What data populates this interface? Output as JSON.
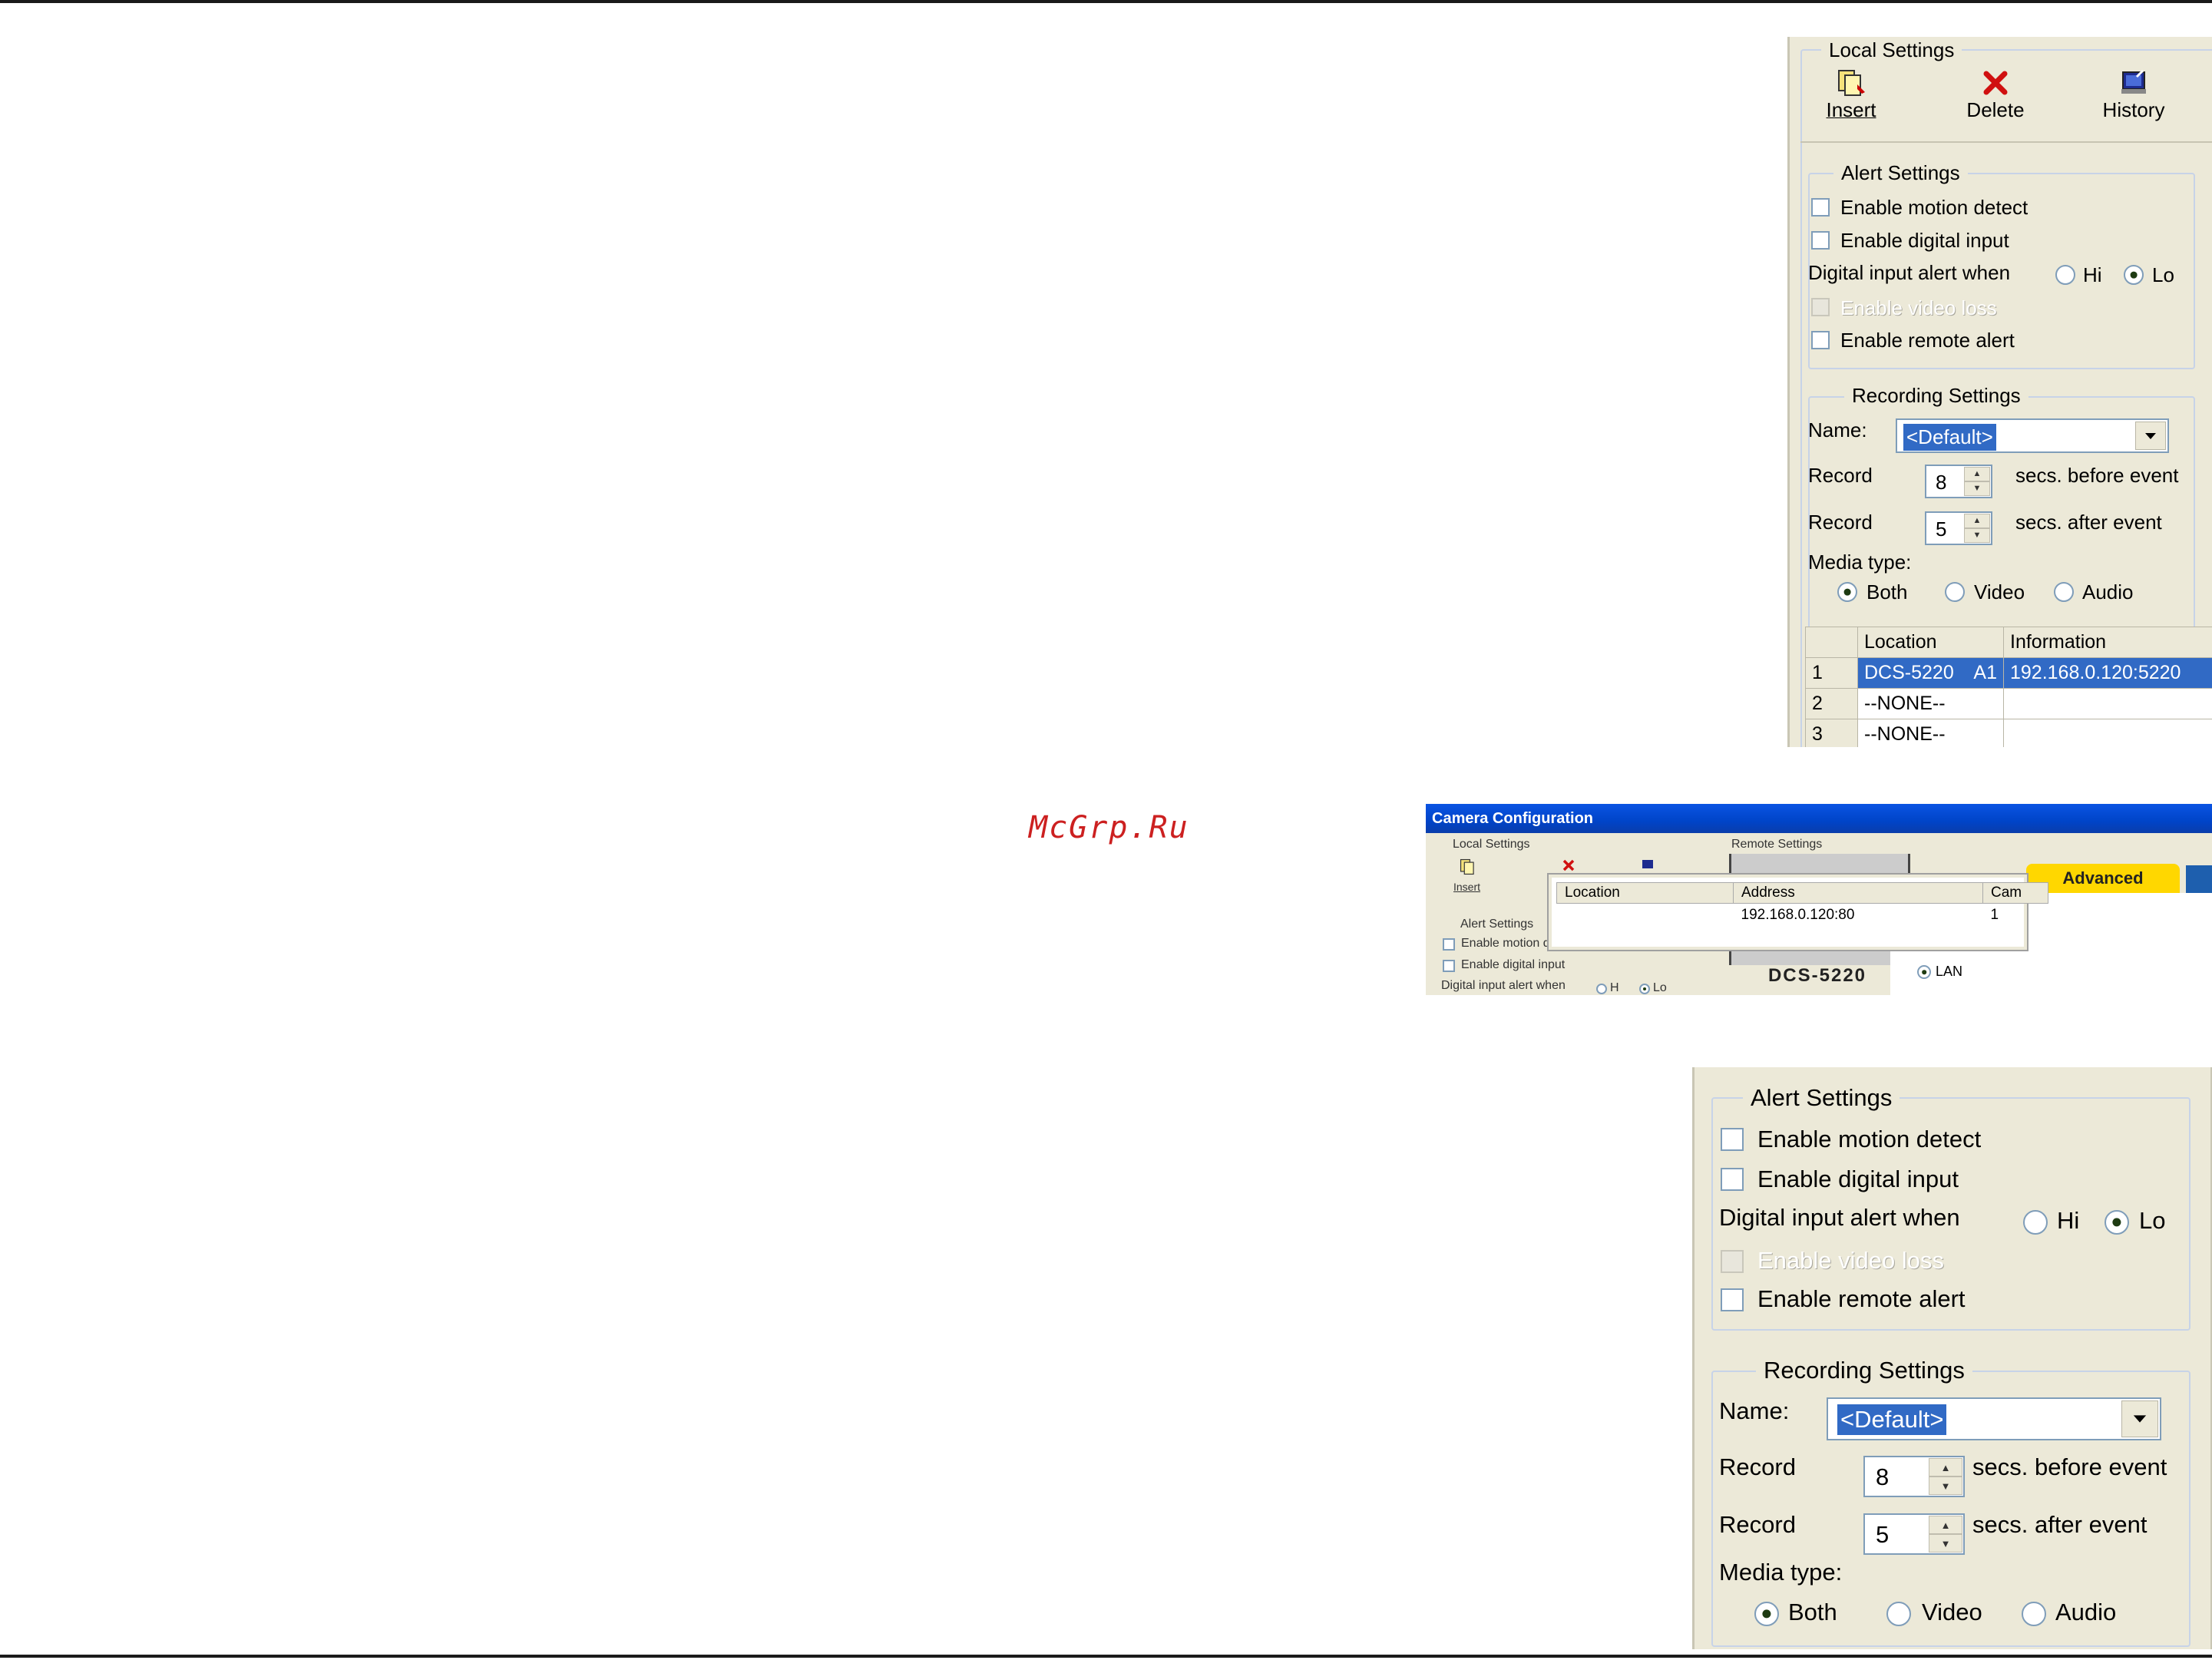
{
  "watermark": "McGrp.Ru",
  "top_panel": {
    "local_settings_legend": "Local Settings",
    "toolbar": {
      "insert_label": "Insert",
      "delete_label": "Delete",
      "history_label": "History"
    },
    "alert_settings": {
      "legend": "Alert Settings",
      "motion_detect": "Enable motion detect",
      "digital_input": "Enable digital input",
      "digital_alert_when": "Digital input alert when",
      "hi": "Hi",
      "lo": "Lo",
      "selected": "Lo",
      "video_loss": "Enable video loss",
      "remote_alert": "Enable remote alert"
    },
    "recording_settings": {
      "legend": "Recording Settings",
      "name_label": "Name:",
      "name_value": "<Default>",
      "record_label": "Record",
      "before_value": "8",
      "before_suffix": "secs. before event",
      "after_value": "5",
      "after_suffix": "secs. after event",
      "media_type_label": "Media type:",
      "both": "Both",
      "video": "Video",
      "audio": "Audio",
      "media_selected": "Both"
    },
    "table": {
      "headers": [
        "",
        "Location",
        "Information"
      ],
      "rows": [
        {
          "num": "1",
          "location": "DCS-5220",
          "cam": "A1",
          "info": "192.168.0.120:5220"
        },
        {
          "num": "2",
          "location": "--NONE--",
          "cam": "",
          "info": ""
        },
        {
          "num": "3",
          "location": "--NONE--",
          "cam": "",
          "info": ""
        }
      ]
    }
  },
  "camera_config": {
    "title": "Camera Configuration",
    "local_settings": "Local Settings",
    "remote_settings": "Remote Settings",
    "insert": "Insert",
    "alert_settings": "Alert Settings",
    "enable_motion": "Enable motion detect",
    "enable_digital": "Enable digital input",
    "digital_alert_when": "Digital input alert when",
    "hi": "H",
    "lo": "Lo",
    "popup": {
      "headers": [
        "Location",
        "Address",
        "Cam"
      ],
      "row": {
        "location": "",
        "address": "192.168.0.120:80",
        "cam": "1"
      }
    },
    "advanced_tab": "Advanced",
    "lan": "LAN",
    "model": "DCS-5220"
  },
  "bottom_panel": {
    "alert_settings": {
      "legend": "Alert Settings",
      "motion_detect": "Enable motion detect",
      "digital_input": "Enable digital input",
      "digital_alert_when": "Digital input alert when",
      "hi": "Hi",
      "lo": "Lo",
      "video_loss": "Enable video loss",
      "remote_alert": "Enable remote alert"
    },
    "recording_settings": {
      "legend": "Recording Settings",
      "name_label": "Name:",
      "name_value": "<Default>",
      "record_label": "Record",
      "before_value": "8",
      "before_suffix": "secs. before event",
      "after_value": "5",
      "after_suffix": "secs. after event",
      "media_type_label": "Media type:",
      "both": "Both",
      "video": "Video",
      "audio": "Audio"
    }
  },
  "colors": {
    "panel_bg": "#ece9d8",
    "selection": "#316ac5",
    "groupbox_border": "#c7d3e8",
    "watermark": "#cc2020",
    "advanced_tab": "#ffd700"
  }
}
